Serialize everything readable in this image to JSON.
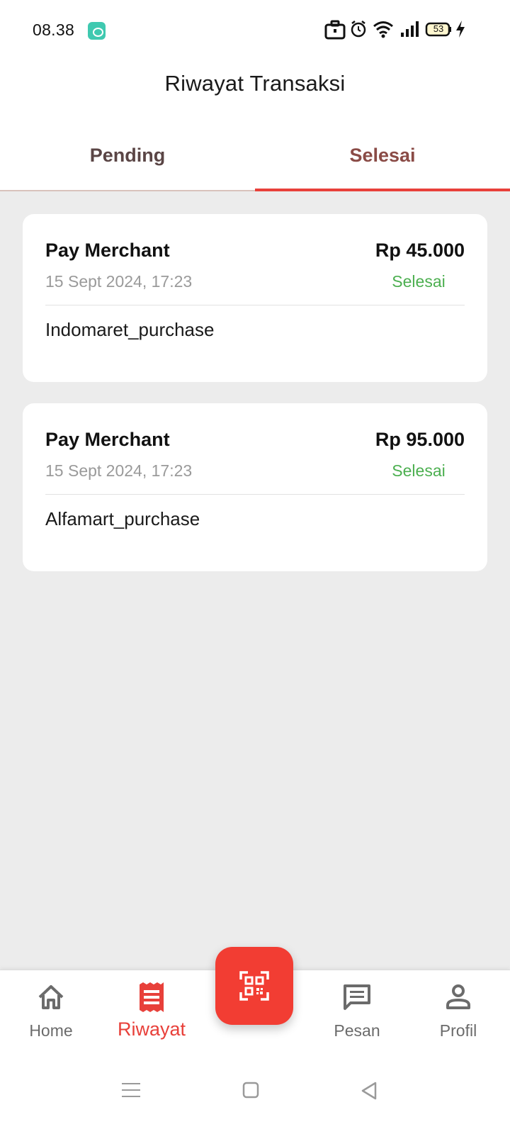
{
  "status_bar": {
    "time": "08.38",
    "battery": "53",
    "icons": [
      "app-notification-icon",
      "briefcase-icon",
      "alarm-icon",
      "wifi-icon",
      "signal-icon",
      "battery-icon",
      "charging-icon"
    ]
  },
  "header": {
    "title": "Riwayat Transaksi"
  },
  "tabs": [
    {
      "label": "Pending",
      "active": false
    },
    {
      "label": "Selesai",
      "active": true
    }
  ],
  "transactions": [
    {
      "type": "Pay Merchant",
      "amount": "Rp 45.000",
      "date": "15 Sept 2024, 17:23",
      "status": "Selesai",
      "description": "Indomaret_purchase"
    },
    {
      "type": "Pay Merchant",
      "amount": "Rp 95.000",
      "date": "15 Sept 2024, 17:23",
      "status": "Selesai",
      "description": "Alfamart_purchase"
    }
  ],
  "bottom_nav": {
    "items": [
      {
        "label": "Home",
        "icon": "home-icon",
        "active": false
      },
      {
        "label": "Riwayat",
        "icon": "receipt-icon",
        "active": true
      },
      {
        "label": "Pesan",
        "icon": "message-icon",
        "active": false
      },
      {
        "label": "Profil",
        "icon": "profile-icon",
        "active": false
      }
    ],
    "fab_icon": "qr-scan-icon"
  },
  "colors": {
    "accent": "#e8403a",
    "fab": "#f23d33",
    "status_success": "#4caf50",
    "tab_active_text": "#8a4b46",
    "background": "#ececec"
  }
}
